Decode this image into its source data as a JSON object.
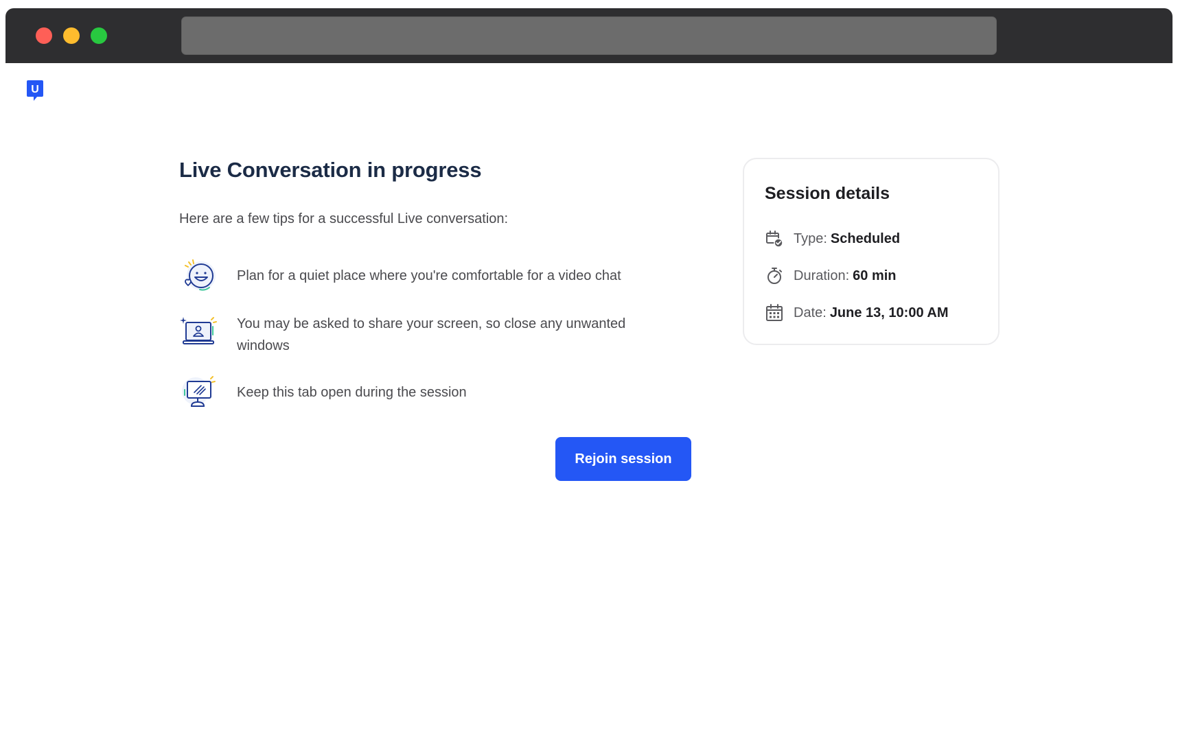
{
  "window": {
    "controls": [
      "close",
      "minimize",
      "maximize"
    ],
    "address_bar_value": ""
  },
  "brand": {
    "logo_letter": "U",
    "color": "#2457f5"
  },
  "main": {
    "title": "Live Conversation in progress",
    "intro": "Here are a few tips for a successful Live conversation:",
    "tips": [
      {
        "icon": "happy-face-icon",
        "text": "Plan for a quiet place where you're comfortable for a video chat"
      },
      {
        "icon": "laptop-user-icon",
        "text": "You may be asked to share your screen, so close any unwanted windows"
      },
      {
        "icon": "monitor-icon",
        "text": "Keep this tab open during the session"
      }
    ],
    "rejoin_label": "Rejoin session"
  },
  "session": {
    "title": "Session details",
    "rows": [
      {
        "icon": "calendar-check-icon",
        "label": "Type:",
        "value": "Scheduled"
      },
      {
        "icon": "stopwatch-icon",
        "label": "Duration:",
        "value": "60 min"
      },
      {
        "icon": "calendar-icon",
        "label": "Date:",
        "value": "June 13, 10:00 AM"
      }
    ]
  },
  "colors": {
    "primary": "#2457f5",
    "title": "#1b2b46",
    "icon_navy": "#1f3a93",
    "icon_accent_yellow": "#f3c12c",
    "icon_accent_green": "#3ec69a"
  }
}
